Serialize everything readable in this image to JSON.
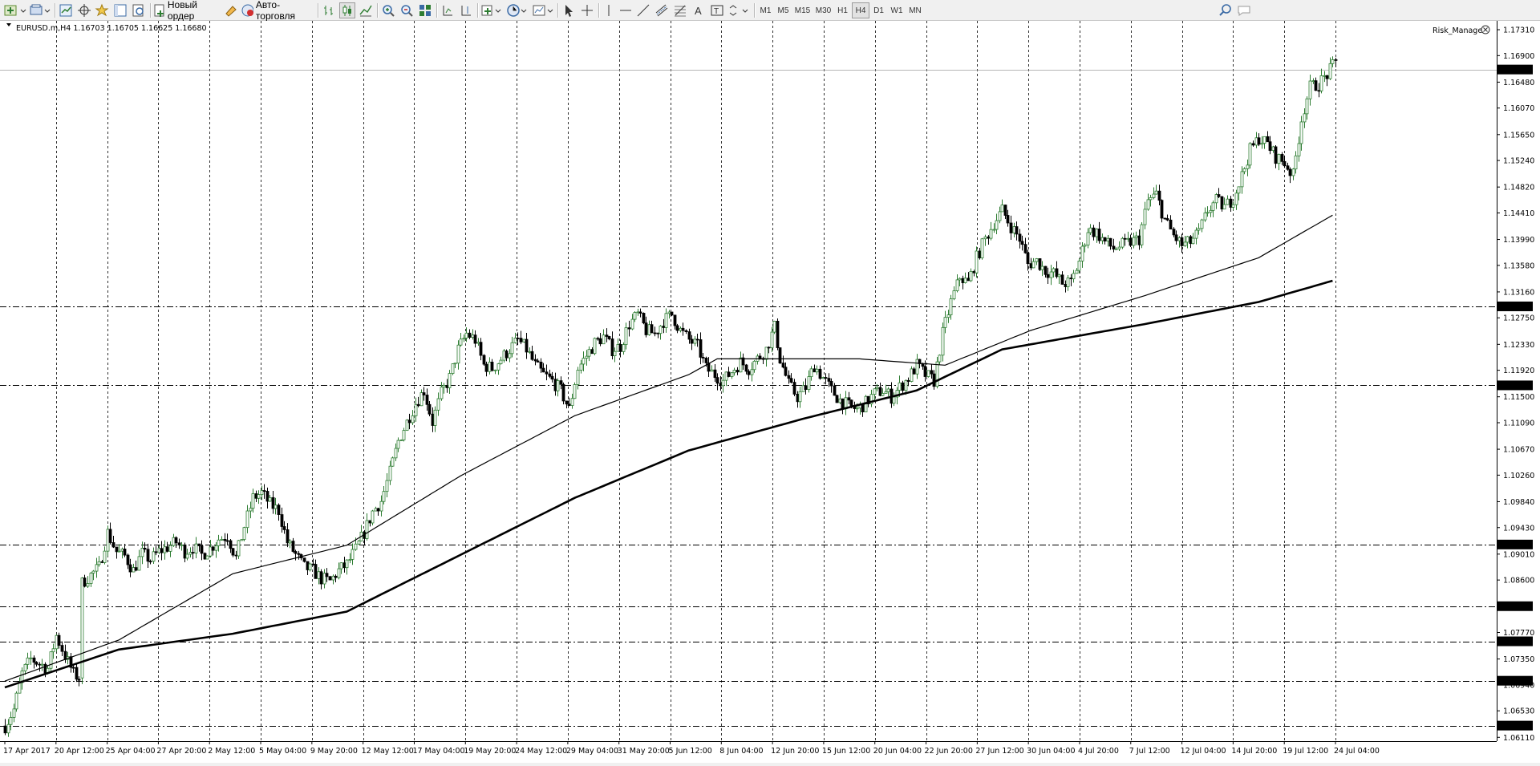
{
  "toolbar": {
    "new_order_label": "Новый ордер",
    "auto_trading_label": "Авто-торговля",
    "timeframes": [
      "M1",
      "M5",
      "M15",
      "M30",
      "H1",
      "H4",
      "D1",
      "W1",
      "MN"
    ],
    "active_timeframe": "H4"
  },
  "chart": {
    "header": "EURUSD.m,H4  1.16703 1.16705 1.16625 1.16680",
    "indicator": "Risk_Manager",
    "price_axis_labels": [
      "1.17310",
      "1.16900",
      "1.16480",
      "1.16070",
      "1.15650",
      "1.15240",
      "1.14820",
      "1.14410",
      "1.13990",
      "1.13580",
      "1.13160",
      "1.12750",
      "1.12330",
      "1.11920",
      "1.11500",
      "1.11090",
      "1.10670",
      "1.10260",
      "1.09840",
      "1.09430",
      "1.09010",
      "1.08600",
      "1.07770",
      "1.07350",
      "1.06940",
      "1.06530",
      "1.06110"
    ],
    "level_labels": [
      "1.16680",
      "1.12931",
      "1.11681",
      "1.09162",
      "1.08186",
      "1.07630",
      "1.07006",
      "1.06296"
    ],
    "time_axis_labels": [
      "17 Apr 2017",
      "20 Apr 12:00",
      "25 Apr 04:00",
      "27 Apr 20:00",
      "2 May 12:00",
      "5 May 04:00",
      "9 May 20:00",
      "12 May 12:00",
      "17 May 04:00",
      "19 May 20:00",
      "24 May 12:00",
      "29 May 04:00",
      "31 May 20:00",
      "5 Jun 12:00",
      "8 Jun 04:00",
      "12 Jun 20:00",
      "15 Jun 12:00",
      "20 Jun 04:00",
      "22 Jun 20:00",
      "27 Jun 12:00",
      "30 Jun 04:00",
      "4 Jul 20:00",
      "7 Jul 12:00",
      "12 Jul 04:00",
      "14 Jul 20:00",
      "19 Jul 12:00",
      "24 Jul 04:00"
    ],
    "colors": {
      "bull": "#2e7d32",
      "bear": "#000000",
      "grid": "#000000",
      "background": "#ffffff"
    }
  },
  "chart_data": {
    "type": "candlestick",
    "symbol": "EURUSD.m",
    "timeframe": "H4",
    "ohlc_last": {
      "open": 1.16703,
      "high": 1.16705,
      "low": 1.16625,
      "close": 1.1668
    },
    "ylim": [
      1.0605,
      1.1745
    ],
    "x_range": [
      "17 Apr 2017",
      "24 Jul 04:00"
    ],
    "horizontal_levels": [
      1.1668,
      1.12931,
      1.11681,
      1.09162,
      1.08186,
      1.0763,
      1.07006,
      1.06296
    ],
    "close_path": [
      [
        0,
        1.0629
      ],
      [
        3,
        1.0655
      ],
      [
        6,
        1.0712
      ],
      [
        9,
        1.0735
      ],
      [
        12,
        1.0728
      ],
      [
        15,
        1.072
      ],
      [
        18,
        1.0772
      ],
      [
        21,
        1.074
      ],
      [
        24,
        1.0712
      ],
      [
        26,
        1.0705
      ],
      [
        27,
        1.0855
      ],
      [
        30,
        1.0868
      ],
      [
        33,
        1.088
      ],
      [
        36,
        1.0935
      ],
      [
        39,
        1.0905
      ],
      [
        42,
        1.0898
      ],
      [
        45,
        1.0875
      ],
      [
        48,
        1.0902
      ],
      [
        51,
        1.0892
      ],
      [
        54,
        1.0905
      ],
      [
        57,
        1.0912
      ],
      [
        60,
        1.092
      ],
      [
        63,
        1.0905
      ],
      [
        66,
        1.0912
      ],
      [
        69,
        1.09
      ],
      [
        72,
        1.091
      ],
      [
        75,
        1.0925
      ],
      [
        78,
        1.093
      ],
      [
        81,
        1.0895
      ],
      [
        84,
        1.0945
      ],
      [
        87,
        1.099
      ],
      [
        90,
        1.0998
      ],
      [
        93,
        1.098
      ],
      [
        96,
        1.097
      ],
      [
        99,
        1.092
      ],
      [
        102,
        1.09
      ],
      [
        105,
        1.088
      ],
      [
        108,
        1.0875
      ],
      [
        111,
        1.0862
      ],
      [
        114,
        1.0858
      ],
      [
        117,
        1.0875
      ],
      [
        120,
        1.0885
      ],
      [
        123,
        1.0908
      ],
      [
        126,
        1.0935
      ],
      [
        129,
        1.0968
      ],
      [
        132,
        1.0985
      ],
      [
        135,
        1.103
      ],
      [
        138,
        1.108
      ],
      [
        141,
        1.111
      ],
      [
        144,
        1.114
      ],
      [
        147,
        1.116
      ],
      [
        150,
        1.111
      ],
      [
        153,
        1.1155
      ],
      [
        156,
        1.118
      ],
      [
        159,
        1.1225
      ],
      [
        162,
        1.125
      ],
      [
        165,
        1.124
      ],
      [
        168,
        1.12
      ],
      [
        171,
        1.1195
      ],
      [
        174,
        1.121
      ],
      [
        177,
        1.1225
      ],
      [
        180,
        1.124
      ],
      [
        183,
        1.1225
      ],
      [
        186,
        1.12
      ],
      [
        189,
        1.1185
      ],
      [
        192,
        1.1175
      ],
      [
        195,
        1.116
      ],
      [
        198,
        1.113
      ],
      [
        201,
        1.1195
      ],
      [
        204,
        1.1215
      ],
      [
        207,
        1.1235
      ],
      [
        210,
        1.1245
      ],
      [
        213,
        1.1225
      ],
      [
        216,
        1.123
      ],
      [
        219,
        1.1265
      ],
      [
        222,
        1.128
      ],
      [
        225,
        1.1255
      ],
      [
        228,
        1.125
      ],
      [
        231,
        1.127
      ],
      [
        234,
        1.128
      ],
      [
        237,
        1.1255
      ],
      [
        240,
        1.124
      ],
      [
        243,
        1.123
      ],
      [
        246,
        1.1195
      ],
      [
        249,
        1.1185
      ],
      [
        252,
        1.1175
      ],
      [
        255,
        1.119
      ],
      [
        258,
        1.1205
      ],
      [
        261,
        1.1195
      ],
      [
        264,
        1.121
      ],
      [
        267,
        1.1225
      ],
      [
        270,
        1.126
      ],
      [
        272,
        1.121
      ],
      [
        275,
        1.117
      ],
      [
        278,
        1.115
      ],
      [
        281,
        1.1165
      ],
      [
        284,
        1.12
      ],
      [
        287,
        1.118
      ],
      [
        290,
        1.116
      ],
      [
        293,
        1.1145
      ],
      [
        296,
        1.1135
      ],
      [
        299,
        1.113
      ],
      [
        302,
        1.114
      ],
      [
        305,
        1.1155
      ],
      [
        308,
        1.116
      ],
      [
        311,
        1.115
      ],
      [
        314,
        1.1165
      ],
      [
        317,
        1.118
      ],
      [
        320,
        1.12
      ],
      [
        323,
        1.1185
      ],
      [
        326,
        1.1175
      ],
      [
        329,
        1.125
      ],
      [
        332,
        1.13
      ],
      [
        335,
        1.134
      ],
      [
        338,
        1.133
      ],
      [
        341,
        1.137
      ],
      [
        344,
        1.14
      ],
      [
        347,
        1.1425
      ],
      [
        350,
        1.1445
      ],
      [
        353,
        1.142
      ],
      [
        356,
        1.14
      ],
      [
        359,
        1.136
      ],
      [
        362,
        1.1365
      ],
      [
        365,
        1.135
      ],
      [
        368,
        1.1345
      ],
      [
        371,
        1.133
      ],
      [
        374,
        1.133
      ],
      [
        377,
        1.1365
      ],
      [
        380,
        1.1415
      ],
      [
        383,
        1.141
      ],
      [
        386,
        1.1395
      ],
      [
        389,
        1.1385
      ],
      [
        392,
        1.139
      ],
      [
        395,
        1.1395
      ],
      [
        398,
        1.14
      ],
      [
        401,
        1.146
      ],
      [
        404,
        1.147
      ],
      [
        407,
        1.143
      ],
      [
        410,
        1.1405
      ],
      [
        413,
        1.139
      ],
      [
        416,
        1.1395
      ],
      [
        419,
        1.141
      ],
      [
        422,
        1.1445
      ],
      [
        425,
        1.146
      ],
      [
        428,
        1.145
      ],
      [
        431,
        1.1465
      ],
      [
        434,
        1.15
      ],
      [
        437,
        1.154
      ],
      [
        440,
        1.156
      ],
      [
        443,
        1.155
      ],
      [
        446,
        1.153
      ],
      [
        449,
        1.152
      ],
      [
        452,
        1.15
      ],
      [
        455,
        1.159
      ],
      [
        458,
        1.164
      ],
      [
        461,
        1.1645
      ],
      [
        464,
        1.166
      ],
      [
        467,
        1.168
      ]
    ],
    "ma_fast": [
      [
        0,
        1.07
      ],
      [
        40,
        1.0765
      ],
      [
        80,
        1.087
      ],
      [
        120,
        1.0915
      ],
      [
        160,
        1.1025
      ],
      [
        200,
        1.112
      ],
      [
        240,
        1.1185
      ],
      [
        250,
        1.121
      ],
      [
        300,
        1.121
      ],
      [
        330,
        1.12
      ],
      [
        360,
        1.1255
      ],
      [
        400,
        1.131
      ],
      [
        440,
        1.137
      ],
      [
        467,
        1.144
      ]
    ],
    "ma_slow": [
      [
        0,
        1.069
      ],
      [
        40,
        1.075
      ],
      [
        80,
        1.0775
      ],
      [
        120,
        1.081
      ],
      [
        160,
        1.09
      ],
      [
        200,
        1.099
      ],
      [
        240,
        1.1065
      ],
      [
        280,
        1.1115
      ],
      [
        320,
        1.116
      ],
      [
        350,
        1.1225
      ],
      [
        400,
        1.1265
      ],
      [
        440,
        1.13
      ],
      [
        467,
        1.1335
      ]
    ]
  }
}
